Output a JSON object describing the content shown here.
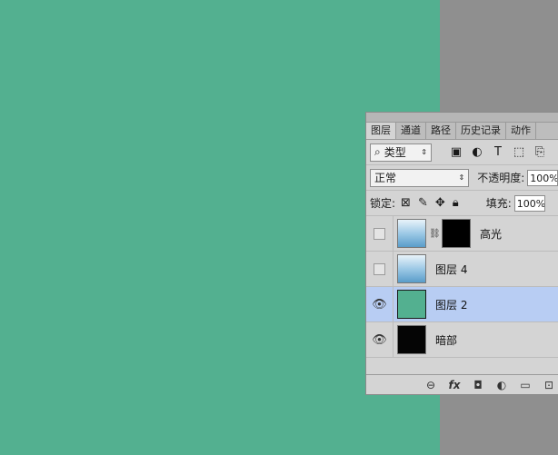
{
  "tabs": [
    "图层",
    "通道",
    "路径",
    "历史记录",
    "动作"
  ],
  "filter": {
    "label": "类型",
    "search_icon": "search-icon",
    "spinner": "⇕"
  },
  "filter_icons": [
    "image-filter-icon",
    "adjustment-filter-icon",
    "type-filter-icon",
    "shape-filter-icon",
    "smart-object-filter-icon"
  ],
  "blend": {
    "mode": "正常",
    "opacity_label": "不透明度:",
    "opacity_value": "100%"
  },
  "lock": {
    "label": "锁定:",
    "fill_label": "填充:",
    "fill_value": "100%"
  },
  "layers": [
    {
      "name": "高光",
      "visible": false,
      "thumb": "sky",
      "has_mask": true
    },
    {
      "name": "图层 4",
      "visible": false,
      "thumb": "sky",
      "has_mask": false
    },
    {
      "name": "图层 2",
      "visible": true,
      "thumb": "green",
      "selected": true
    },
    {
      "name": "暗部",
      "visible": true,
      "thumb": "dark"
    }
  ],
  "colors": {
    "canvas": "#53b090",
    "workspace": "#8f8f8f",
    "selected_layer": "#b8cdf3"
  },
  "bottom_icons": [
    "link-layers-icon",
    "fx-icon",
    "add-mask-icon",
    "adjustment-layer-icon",
    "new-group-icon",
    "new-layer-icon"
  ],
  "bottom_glyphs": {
    "link": "⊖",
    "fx": "fx",
    "mask": "◘",
    "adjust": "◐",
    "group": "▭",
    "new": "⊡"
  }
}
